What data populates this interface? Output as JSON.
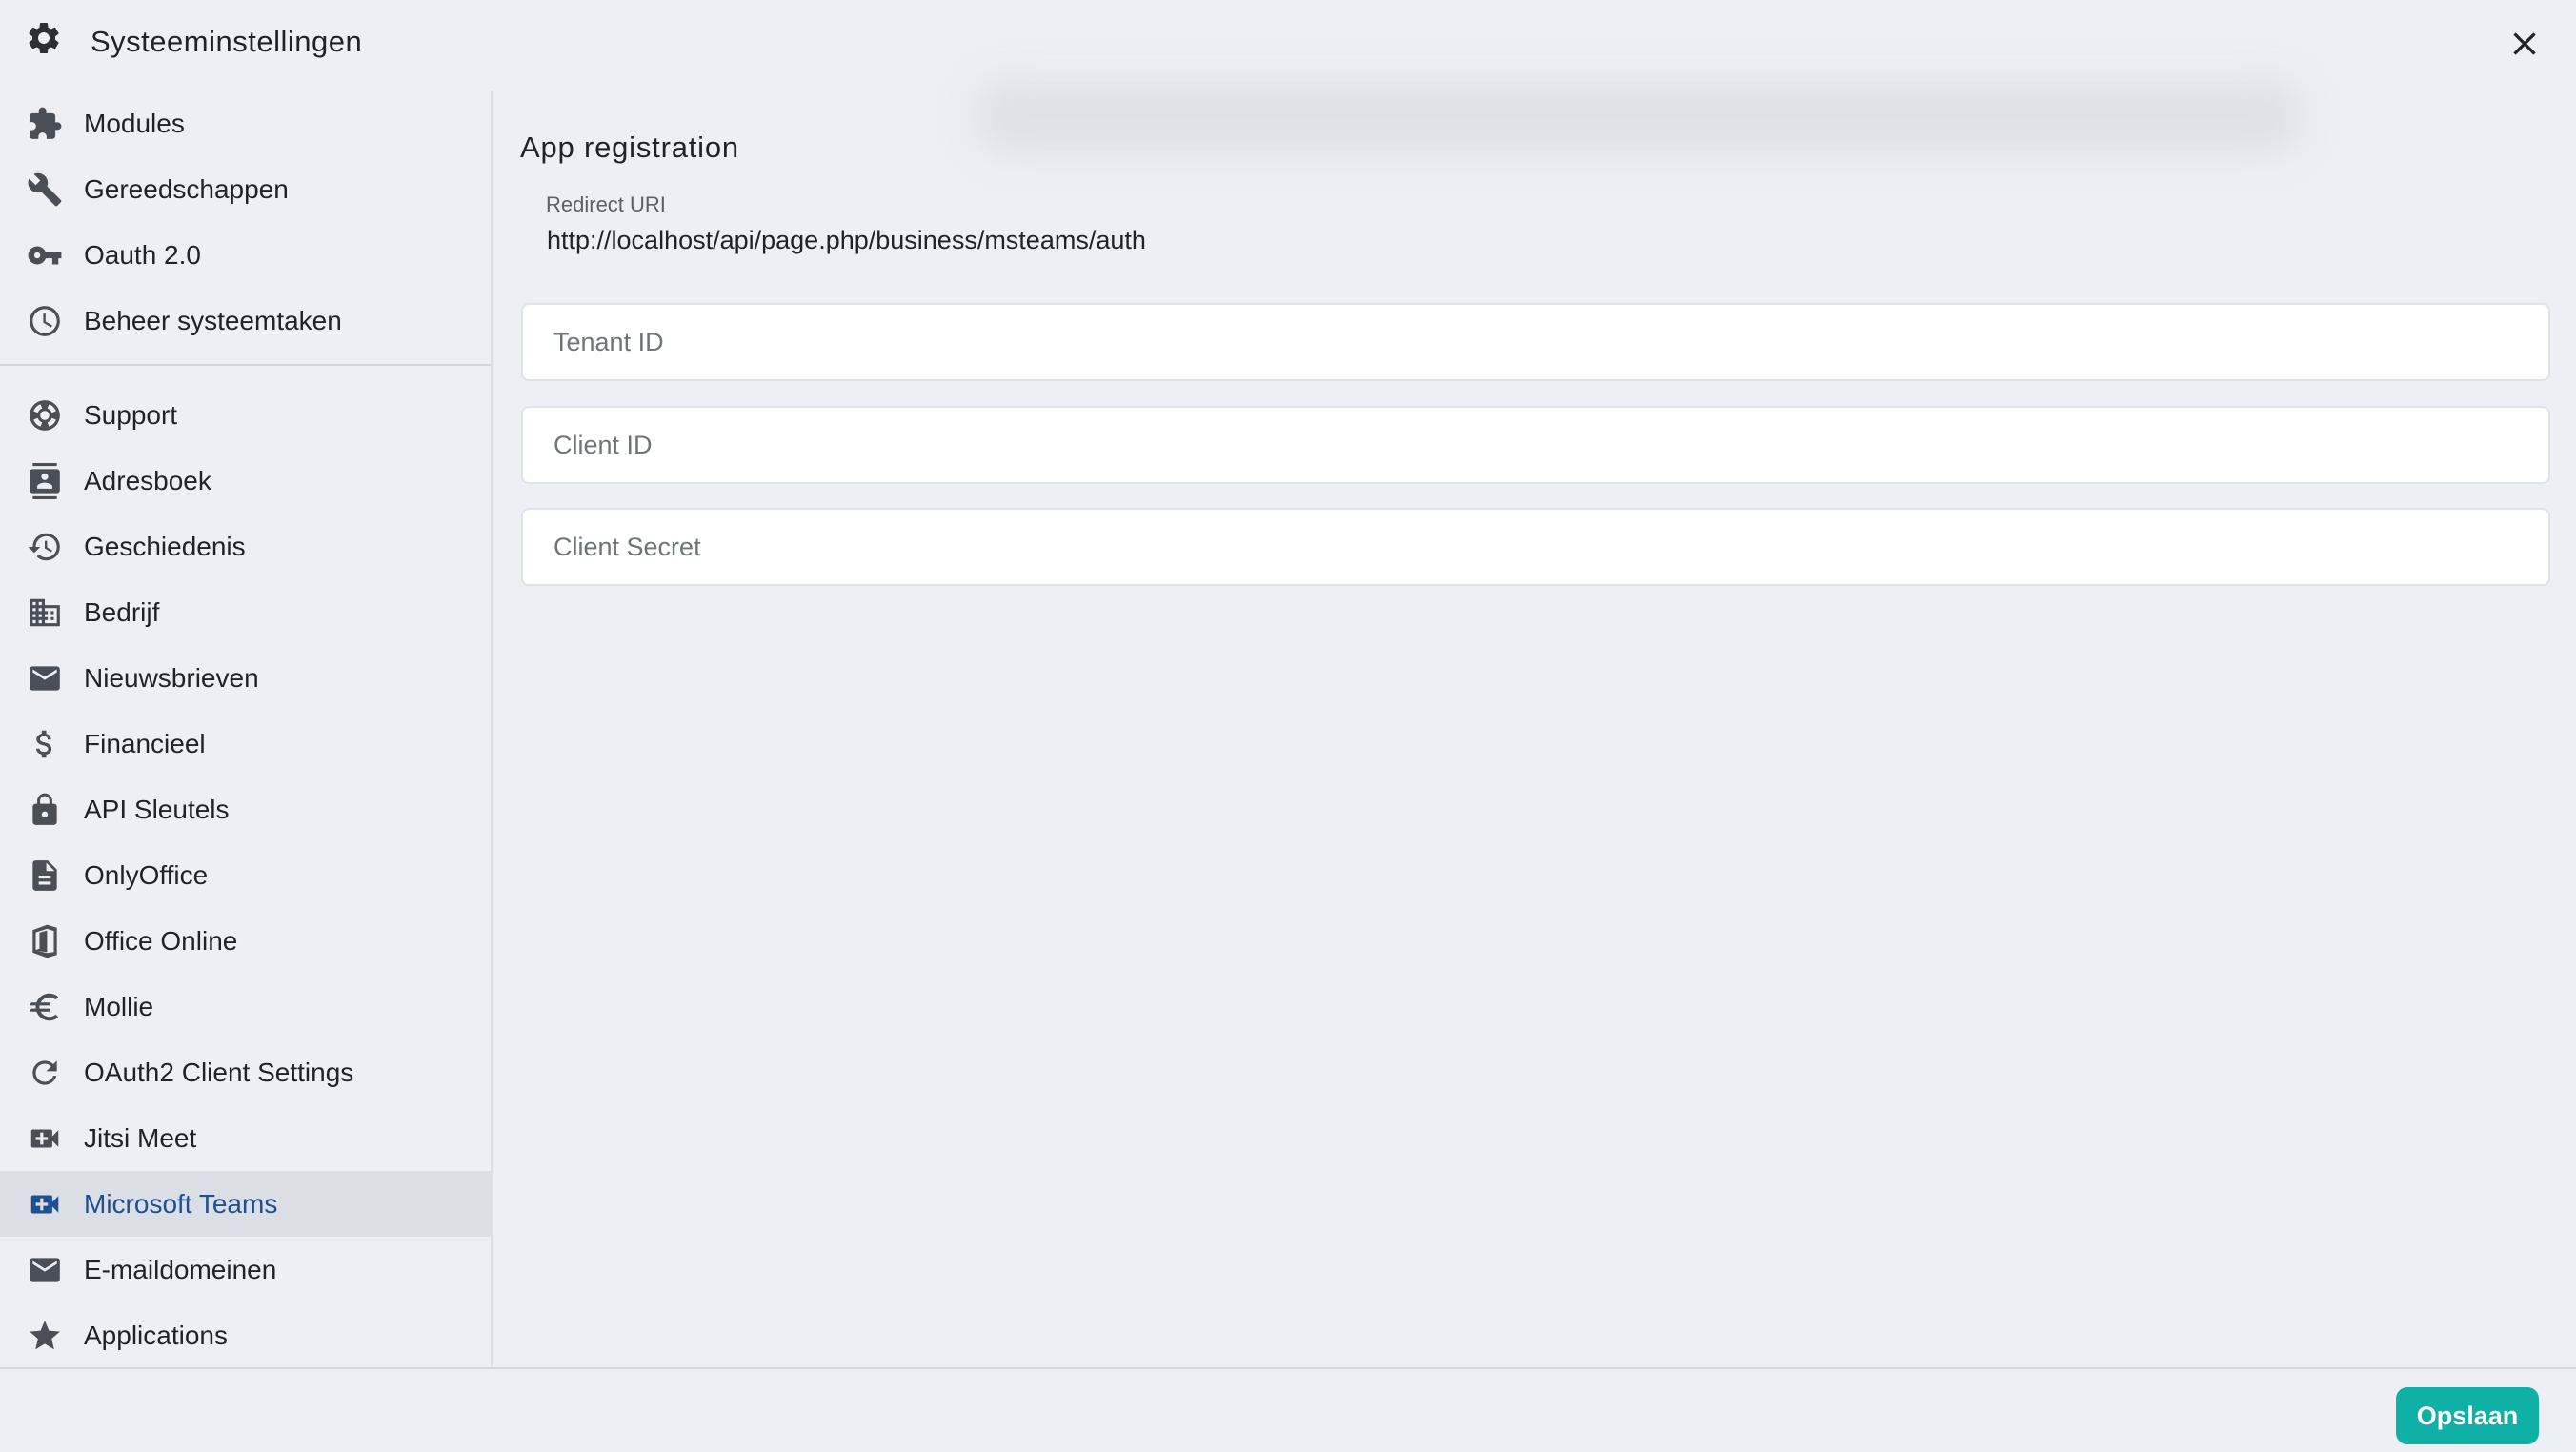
{
  "window": {
    "title": "Systeeminstellingen",
    "title_icon": "gear-icon",
    "close_icon": "close-icon"
  },
  "sidebar": {
    "group1": [
      {
        "label": "Modules",
        "icon": "puzzle-icon"
      },
      {
        "label": "Gereedschappen",
        "icon": "wrench-icon"
      },
      {
        "label": "Oauth 2.0",
        "icon": "key-icon"
      },
      {
        "label": "Beheer systeemtaken",
        "icon": "clock-icon"
      }
    ],
    "group2": [
      {
        "label": "Support",
        "icon": "lifebuoy-icon"
      },
      {
        "label": "Adresboek",
        "icon": "contact-card-icon"
      },
      {
        "label": "Geschiedenis",
        "icon": "history-icon"
      },
      {
        "label": "Bedrijf",
        "icon": "building-icon"
      },
      {
        "label": "Nieuwsbrieven",
        "icon": "mail-icon"
      },
      {
        "label": "Financieel",
        "icon": "dollar-icon"
      },
      {
        "label": "API Sleutels",
        "icon": "lock-icon"
      },
      {
        "label": "OnlyOffice",
        "icon": "document-icon"
      },
      {
        "label": "Office Online",
        "icon": "office-icon"
      },
      {
        "label": "Mollie",
        "icon": "euro-icon"
      },
      {
        "label": "OAuth2 Client Settings",
        "icon": "refresh-icon"
      },
      {
        "label": "Jitsi Meet",
        "icon": "video-add-icon"
      },
      {
        "label": "Microsoft Teams",
        "icon": "video-add-icon",
        "active": true
      },
      {
        "label": "E-maildomeinen",
        "icon": "mail-icon"
      },
      {
        "label": "Applications",
        "icon": "star-icon"
      }
    ]
  },
  "main": {
    "section_title": "App registration",
    "redirect_uri_label": "Redirect URI",
    "redirect_uri_value": "http://localhost/api/page.php/business/msteams/auth",
    "fields": {
      "tenant_id_placeholder": "Tenant ID",
      "client_id_placeholder": "Client ID",
      "client_secret_placeholder": "Client Secret"
    }
  },
  "footer": {
    "save_label": "Opslaan"
  },
  "colors": {
    "background": "#edeff4",
    "active_item_bg": "#dcdee6",
    "active_item_text": "#1d4f91",
    "icon_gray": "#4a4f57",
    "save_button": "#0fb0a6"
  }
}
